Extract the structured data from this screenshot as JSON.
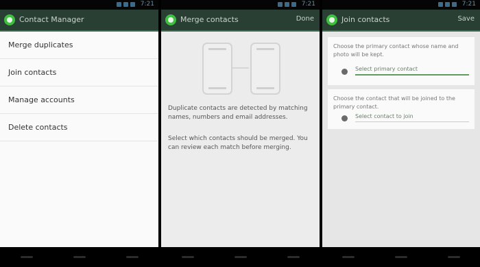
{
  "statusbar": {
    "time": "7:21"
  },
  "screens": [
    {
      "title": "Contact Manager",
      "list": [
        "Merge duplicates",
        "Join contacts",
        "Manage accounts",
        "Delete contacts"
      ]
    },
    {
      "title": "Merge contacts",
      "action": "Done",
      "paragraphs": [
        "Duplicate contacts are detected by matching names, numbers and email addresses.",
        "Select which contacts should be merged. You can review each match before merging."
      ]
    },
    {
      "title": "Join contacts",
      "action": "Save",
      "cards": [
        {
          "description": "Choose the primary contact whose name and photo will be kept.",
          "value": "Select primary contact"
        },
        {
          "description": "Choose the contact that will be joined to the primary contact.",
          "value": "Select contact to join"
        }
      ]
    }
  ],
  "icons": {
    "app": "contacts-app-icon",
    "nav": [
      "back-icon",
      "home-icon",
      "recent-apps-icon"
    ]
  },
  "colors": {
    "actionbar": "#2a3f33",
    "app_icon": "#3fbf3f",
    "accent": "#5f9a5f"
  }
}
